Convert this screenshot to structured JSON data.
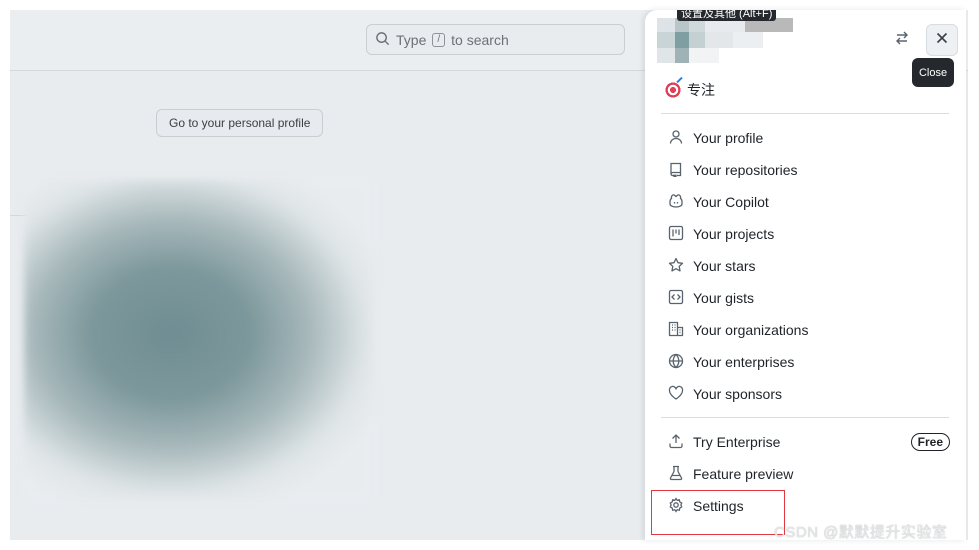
{
  "background": {
    "search": {
      "prefix": "Type",
      "key": "/",
      "suffix": "to search"
    },
    "profile_button": "Go to your personal profile"
  },
  "top_tooltip": "设置及其他 (Alt+F)",
  "panel": {
    "close_tooltip": "Close",
    "status": {
      "label": "专注",
      "emoji": "target-emoji"
    },
    "group1": [
      {
        "label": "Your profile",
        "icon": "person-icon"
      },
      {
        "label": "Your repositories",
        "icon": "repo-icon"
      },
      {
        "label": "Your Copilot",
        "icon": "copilot-icon"
      },
      {
        "label": "Your projects",
        "icon": "project-icon"
      },
      {
        "label": "Your stars",
        "icon": "star-icon"
      },
      {
        "label": "Your gists",
        "icon": "code-square-icon"
      },
      {
        "label": "Your organizations",
        "icon": "organization-icon"
      },
      {
        "label": "Your enterprises",
        "icon": "globe-icon"
      },
      {
        "label": "Your sponsors",
        "icon": "heart-icon"
      }
    ],
    "group2": [
      {
        "label": "Try Enterprise",
        "icon": "upload-icon",
        "badge": "Free"
      },
      {
        "label": "Feature preview",
        "icon": "beaker-icon"
      },
      {
        "label": "Settings",
        "icon": "gear-icon"
      }
    ]
  },
  "watermark": "CSDN @默默提升实验室",
  "colors": {
    "highlight": "#e0393e",
    "tooltip_bg": "#25292e"
  }
}
